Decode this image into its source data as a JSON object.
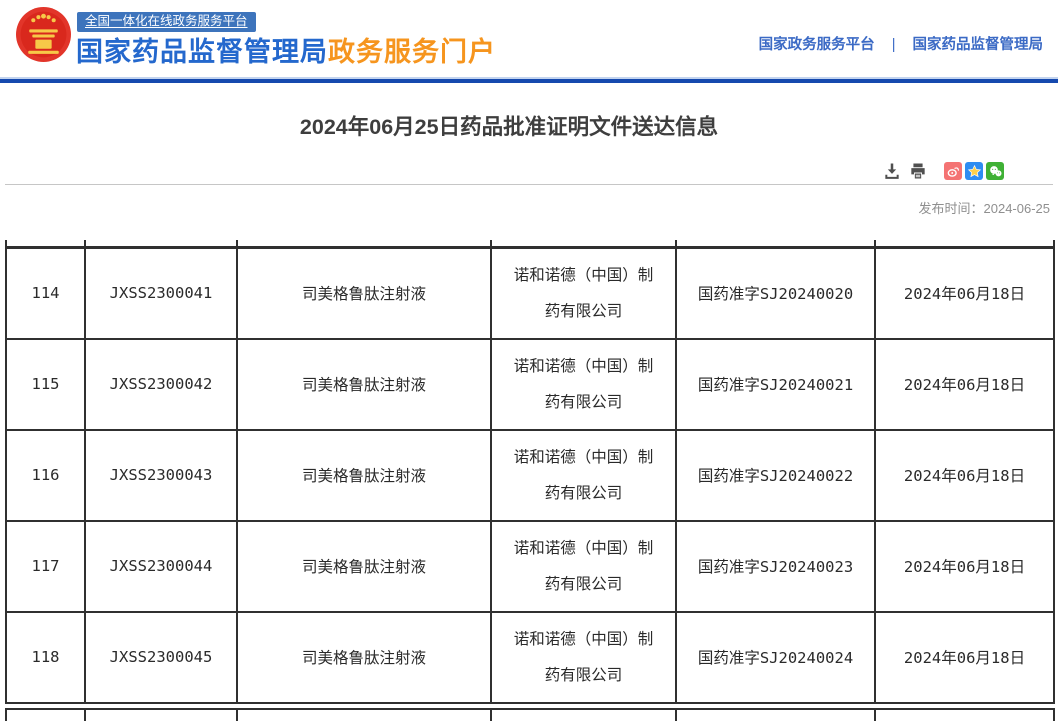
{
  "header": {
    "badge": "全国一体化在线政务服务平台",
    "brand_blue": "国家药品监督管理局",
    "brand_orange": "政务服务门户",
    "nav_links": [
      "国家政务服务平台",
      "国家药品监督管理局"
    ],
    "nav_separator": "|"
  },
  "page": {
    "title": "2024年06月25日药品批准证明文件送达信息",
    "publish_label": "发布时间：",
    "publish_date": "2024-06-25"
  },
  "toolbar": {
    "icons": [
      "download-icon",
      "print-icon",
      "weibo-share-icon",
      "qzone-share-icon",
      "wechat-share-icon"
    ]
  },
  "colors": {
    "brand_blue": "#2468cd",
    "brand_orange": "#f6951e",
    "badge_blue": "#3d74bc",
    "nav_blue": "#3b6ac5",
    "divider_blue": "#1549ae",
    "weibo_red": "#f47373",
    "qzone_blue": "#2e8df2",
    "wechat_green": "#3fb135",
    "emblem_red": "#e2352a"
  },
  "table": {
    "rows": [
      [
        "114",
        "JXSS2300041",
        "司美格鲁肽注射液",
        "诺和诺德（中国）制药有限公司",
        "国药准字SJ20240020",
        "2024年06月18日"
      ],
      [
        "115",
        "JXSS2300042",
        "司美格鲁肽注射液",
        "诺和诺德（中国）制药有限公司",
        "国药准字SJ20240021",
        "2024年06月18日"
      ],
      [
        "116",
        "JXSS2300043",
        "司美格鲁肽注射液",
        "诺和诺德（中国）制药有限公司",
        "国药准字SJ20240022",
        "2024年06月18日"
      ],
      [
        "117",
        "JXSS2300044",
        "司美格鲁肽注射液",
        "诺和诺德（中国）制药有限公司",
        "国药准字SJ20240023",
        "2024年06月18日"
      ],
      [
        "118",
        "JXSS2300045",
        "司美格鲁肽注射液",
        "诺和诺德（中国）制药有限公司",
        "国药准字SJ20240024",
        "2024年06月18日"
      ]
    ]
  }
}
